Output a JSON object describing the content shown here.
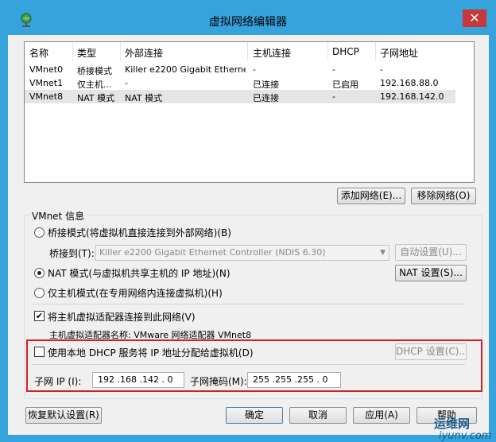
{
  "window": {
    "title": "虚拟网络编辑器",
    "close_glyph": "✕"
  },
  "list": {
    "columns": [
      "名称",
      "类型",
      "外部连接",
      "主机连接",
      "DHCP",
      "子网地址"
    ],
    "rows": [
      [
        "VMnet0",
        "桥接模式",
        "Killer e2200 Gigabit Ethernet...",
        "-",
        "-",
        "-"
      ],
      [
        "VMnet1",
        "仅主机...",
        "-",
        "已连接",
        "已启用",
        "192.168.88.0"
      ],
      [
        "VMnet8",
        "NAT 模式",
        "NAT 模式",
        "已连接",
        "-",
        "192.168.142.0"
      ]
    ],
    "selected_row": 2
  },
  "list_buttons": {
    "add": "添加网络(E)...",
    "remove": "移除网络(O)"
  },
  "vmnet_info": {
    "title": "VMnet 信息",
    "bridge_label": "桥接模式(将虚拟机直接连接到外部网络)(B)",
    "bridge_to_label": "桥接到(T):",
    "bridge_to_value": "Killer e2200 Gigabit Ethernet Controller (NDIS 6.30)",
    "auto_settings": "自动设置(U)...",
    "nat_label": "NAT 模式(与虚拟机共享主机的 IP 地址)(N)",
    "nat_settings": "NAT 设置(S)...",
    "hostonly_label": "仅主机模式(在专用网络内连接虚拟机)(H)",
    "connect_adapter_label": "将主机虚拟适配器连接到此网络(V)",
    "adapter_name_label": "主机虚拟适配器名称: VMware 网络适配器 VMnet8",
    "dhcp_label": "使用本地 DHCP 服务将 IP 地址分配给虚拟机(D)",
    "dhcp_settings": "DHCP 设置(C)...",
    "subnet_ip_label": "子网 IP (I):",
    "subnet_ip_value": "192 .168 .142 . 0",
    "subnet_mask_label": "子网掩码(M):",
    "subnet_mask_value": "255 .255 .255 . 0",
    "mode_selected": "nat",
    "connect_adapter_checked": true,
    "dhcp_checked": false,
    "check_glyph": "✔"
  },
  "footer": {
    "restore": "恢复默认设置(R)",
    "ok": "确定",
    "cancel": "取消",
    "apply": "应用(A)",
    "help": "帮助"
  },
  "watermark": {
    "line1": "运维网",
    "line2": "iyunv.com"
  },
  "colors": {
    "title_bg": "#36a3dc",
    "close": "#c7383a",
    "highlight": "#d32027"
  }
}
